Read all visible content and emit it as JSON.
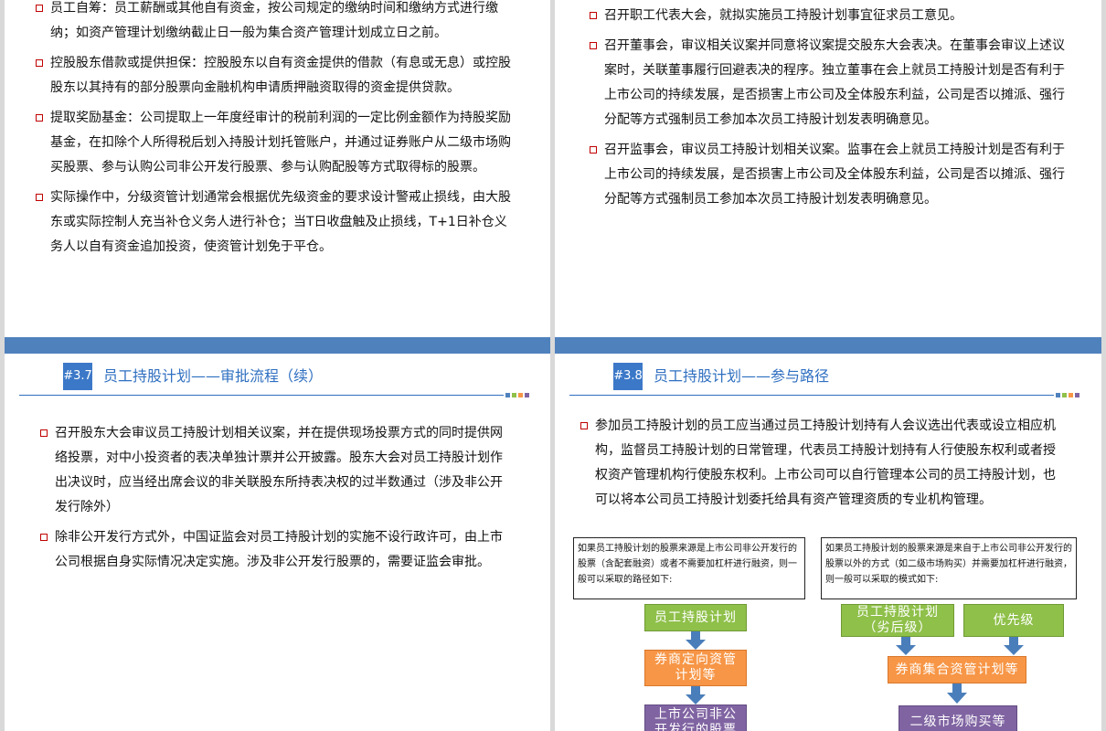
{
  "top_left": {
    "bullets": [
      "员工自筹：员工薪酬或其他自有资金，按公司规定的缴纳时间和缴纳方式进行缴纳；如资产管理计划缴纳截止日一般为集合资产管理计划成立日之前。",
      "控股股东借款或提供担保：控股股东以自有资金提供的借款（有息或无息）或控股股东以其持有的部分股票向金融机构申请质押融资取得的资金提供贷款。",
      "提取奖励基金：公司提取上一年度经审计的税前利润的一定比例金额作为持股奖励基金，在扣除个人所得税后划入持股计划托管账户，并通过证券账户从二级市场购买股票、参与认购公司非公开发行股票、参与认购配股等方式取得标的股票。",
      "实际操作中，分级资管计划通常会根据优先级资金的要求设计警戒止损线，由大股东或实际控制人充当补仓义务人进行补仓；当T日收盘触及止损线，T+1日补仓义务人以自有资金追加投资，使资管计划免于平仓。"
    ]
  },
  "top_right": {
    "bullets": [
      "召开职工代表大会，就拟实施员工持股计划事宜征求员工意见。",
      "召开董事会，审议相关议案并同意将议案提交股东大会表决。在董事会审议上述议案时，关联董事履行回避表决的程序。独立董事在会上就员工持股计划是否有利于上市公司的持续发展，是否损害上市公司及全体股东利益，公司是否以摊派、强行分配等方式强制员工参加本次员工持股计划发表明确意见。",
      "召开监事会，审议员工持股计划相关议案。监事在会上就员工持股计划是否有利于上市公司的持续发展，是否损害上市公司及全体股东利益，公司是否以摊派、强行分配等方式强制员工参加本次员工持股计划发表明确意见。"
    ]
  },
  "bottom_left": {
    "number": "#3.7",
    "title": "员工持股计划——审批流程（续）",
    "bullets": [
      "召开股东大会审议员工持股计划相关议案，并在提供现场投票方式的同时提供网络投票，对中小投资者的表决单独计票并公开披露。股东大会对员工持股计划作出决议时，应当经出席会议的非关联股东所持表决权的过半数通过（涉及非公开发行除外）",
      "除非公开发行方式外，中国证监会对员工持股计划的实施不设行政许可，由上市公司根据自身实际情况决定实施。涉及非公开发行股票的，需要证监会审批。"
    ]
  },
  "bottom_right": {
    "number": "#3.8",
    "title": "员工持股计划——参与路径",
    "bullets": [
      "参加员工持股计划的员工应当通过员工持股计划持有人会议选出代表或设立相应机构，监督员工持股计划的日常管理，代表员工持股计划持有人行使股东权利或者授权资产管理机构行使股东权利。上市公司可以自行管理本公司的员工持股计划，也可以将本公司员工持股计划委托给具有资产管理资质的专业机构管理。"
    ],
    "left_note": "如果员工持股计划的股票来源是上市公司非公开发行的股票（含配套融资）或者不需要加杠杆进行融资，则一般可以采取的路径如下:",
    "right_note": "如果员工持股计划的股票来源是来自于上市公司非公开发行的股票以外的方式（如二级市场购买）并需要加杠杆进行融资，则一般可以采取的模式如下:",
    "left_flow": [
      "员工持股计划",
      "券商定向资管计划等",
      "上市公司非公开发行的股票"
    ],
    "right_flow": {
      "junior": "员工持股计划（劣后级）",
      "senior": "优先级",
      "pool": "券商集合资管计划等",
      "market": "二级市场购买等"
    }
  },
  "colors": {
    "divider_bar": "#4f81bd",
    "title_blue": "#2f6fc1",
    "bullet_red": "#c00000",
    "green": "#8fc04a",
    "orange": "#f79646",
    "purple": "#8064a2",
    "arrow_blue": "#4a7ebb",
    "dots": [
      "#4f81bd",
      "#8fc04a",
      "#f79646",
      "#8064a2"
    ]
  }
}
